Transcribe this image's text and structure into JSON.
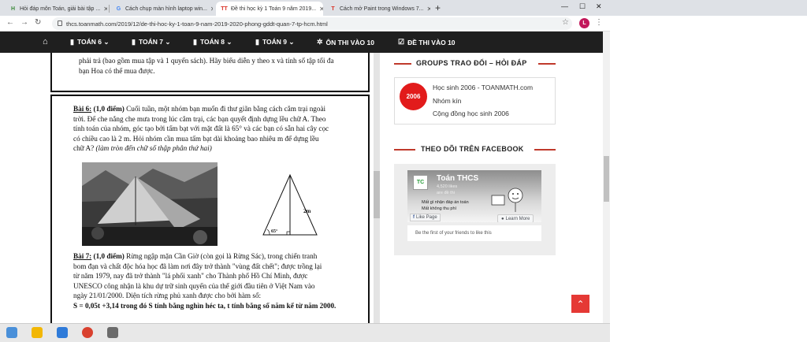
{
  "browser": {
    "tabs": [
      {
        "icon": "H",
        "icon_color": "#3c8a3c",
        "label": "Hỏi đáp môn Toán, giải bài tập ..."
      },
      {
        "icon": "G",
        "icon_color": "#4285f4",
        "label": "Cách chụp màn hình laptop win..."
      },
      {
        "icon": "TT",
        "icon_color": "#d93025",
        "label": "Đề thi học kỳ 1 Toán 9 năm 2019..."
      },
      {
        "icon": "T",
        "icon_color": "#d93025",
        "label": "Cách mở Paint trong Windows 7..."
      }
    ],
    "new_tab": "+",
    "url": "thcs.toanmath.com/2019/12/de-thi-hoc-ky-1-toan-9-nam-2019-2020-phong-gddt-quan-7-tp-hcm.html",
    "profile_initial": "L",
    "minimize": "—",
    "maximize": "☐",
    "close": "✕"
  },
  "site_nav": {
    "items": [
      {
        "icon": "▮",
        "label": "TOÁN 6 ⌄"
      },
      {
        "icon": "▮",
        "label": "TOÁN 7 ⌄"
      },
      {
        "icon": "▮",
        "label": "TOÁN 8 ⌄"
      },
      {
        "icon": "▮",
        "label": "TOÁN 9 ⌄"
      },
      {
        "icon": "✲",
        "label": "ÔN THI VÀO 10"
      },
      {
        "icon": "☑",
        "label": "ĐỀ THI VÀO 10"
      }
    ]
  },
  "document": {
    "top_lines": [
      "phải trả (bao gồm mua tập và 1 quyển sách). Hãy biểu diễn y theo x và tính số tập tối đa",
      "bạn Hoa có thể mua được."
    ],
    "bai6_label": "Bài 6:",
    "bai6_points": " (1,0 điểm)",
    "bai6_lines": [
      " Cuối tuần, một nhóm bạn muốn đi thư giãn bằng cách cắm trại ngoài",
      "trời. Để che nắng che mưa trong lúc cắm trại, các bạn quyết định dựng lều chữ A. Theo",
      "tính toán của nhóm, góc tạo bởi tấm bạt với mặt đất là 65° và các bạn có sẵn hai cây cọc",
      "có chiều cao là 2 m. Hỏi nhóm cần mua tấm bạt dài khoảng bao nhiêu m để dựng lều",
      "chữ A? "
    ],
    "bai6_note": "(làm tròn đến chữ số thập phân thứ hai)",
    "diagram_height": "2m",
    "diagram_angle": "65°",
    "bai7_label": "Bài 7:",
    "bai7_points": " (1,0 điểm)",
    "bai7_lines": [
      " Rừng ngập mặn Cần Giờ (còn gọi là Rừng Sác), trong chiến tranh",
      "bom đạn và chất độc hóa học đã làm nơi đây trở thành \"vùng đất chết\"; được trồng lại",
      "từ năm 1979, nay đã trở thành \"lá phổi xanh\" cho Thành phố Hồ Chí Minh, được",
      "UNESCO công nhận là khu dự trữ sinh quyển của thế giới đầu tiên ở Việt Nam vào",
      "ngày 21/01/2000. Diện tích rừng phủ xanh được cho bởi hàm số:",
      "S = 0,05t +3,14 trong đó S tính bằng nghìn héc ta, t tính bằng số năm kể từ năm 2000."
    ]
  },
  "sidebar": {
    "groups_title": "GROUPS TRAO ĐỔI – HỎI ĐÁP",
    "group_logo": "2006",
    "group_name": "Học sinh 2006 - TOANMATH.com",
    "group_type": "Nhóm kín",
    "group_desc": "Cộng đồng học sinh 2006",
    "fb_title": "THEO DÕI TRÊN FACEBOOK",
    "fb_logo": "TC",
    "fb_page_name": "Toán THCS",
    "fb_likes": "4,520 likes",
    "fb_share": "are đề thi",
    "fb_tag1": "Mất gì nhận đáp án toán",
    "fb_tag2": "Mất không thu phí",
    "fb_like_btn": "Like Page",
    "fb_learn": "Learn More",
    "fb_friends": "Be the first of your friends to like this"
  },
  "back_to_top": "⌃"
}
